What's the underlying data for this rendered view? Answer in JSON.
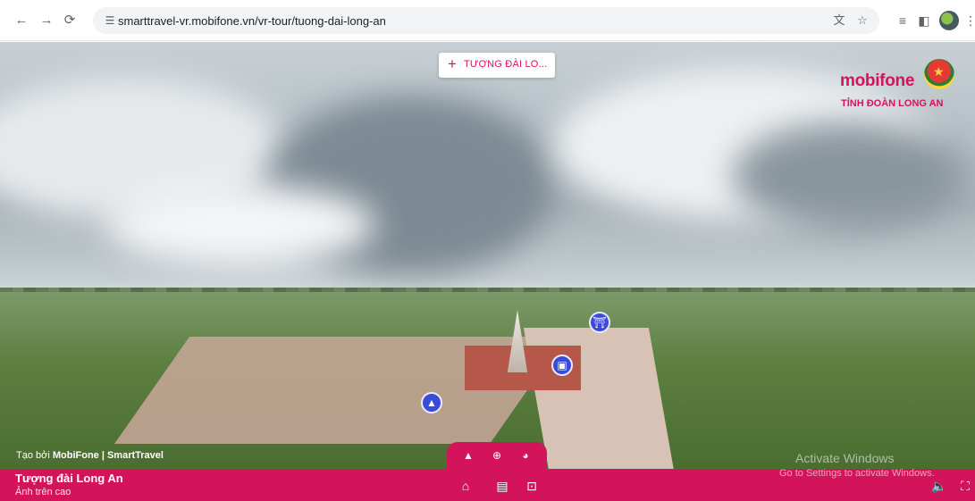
{
  "browser": {
    "url": "smarttravel-vr.mobifone.vn/vr-tour/tuong-dai-long-an",
    "icons": [
      "back-icon",
      "forward-icon",
      "reload-icon",
      "site-settings-icon",
      "translate-icon",
      "star-icon",
      "reading-list-icon",
      "side-panel-icon",
      "profile-icon",
      "more-icon"
    ]
  },
  "tour": {
    "title_button": "TƯỢNG ĐÀI LO...",
    "brand": "mobifone",
    "brand_sub": "TỈNH ĐOÀN LONG AN",
    "credit_prefix": "Tạo bởi ",
    "credit_bold": "MobiFone | SmartTravel",
    "scene_title": "Tượng đài Long An",
    "scene_subtitle": "Ảnh trên cao",
    "accent_color": "#d4145a"
  },
  "os_watermark": {
    "line1": "Activate Windows",
    "line2": "Go to Settings to activate Windows."
  }
}
